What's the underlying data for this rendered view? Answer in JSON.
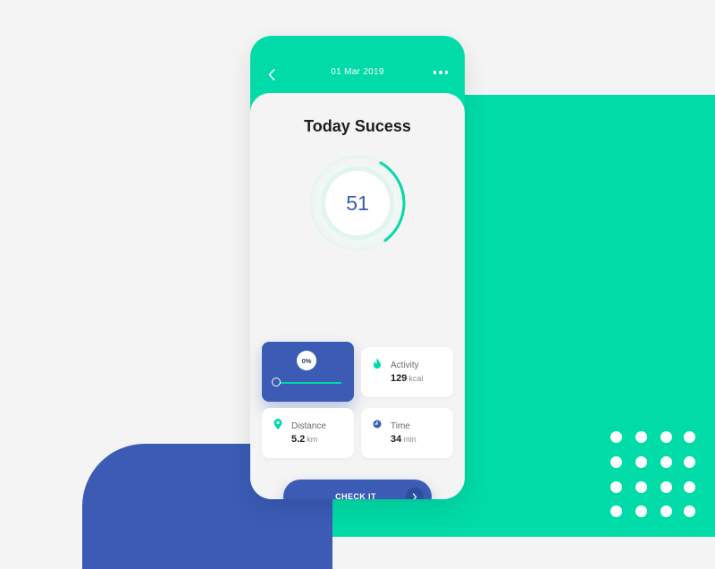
{
  "header": {
    "date": "01 Mar 2019",
    "back_icon": "chevron-left-icon",
    "more_icon": "more-horizontal-icon"
  },
  "title": "Today Sucess",
  "score": {
    "value": "51",
    "progress_fraction": 0.3
  },
  "progress_card": {
    "percent_label": "0%",
    "slider_value": 0
  },
  "cards": {
    "activity": {
      "icon": "flame-icon",
      "label": "Activity",
      "value": "129",
      "unit": "kcal"
    },
    "distance": {
      "icon": "map-pin-icon",
      "label": "Distance",
      "value": "5.2",
      "unit": "km"
    },
    "time": {
      "icon": "clock-icon",
      "label": "Time",
      "value": "34",
      "unit": "min"
    }
  },
  "button": {
    "label": "CHECK IT",
    "icon": "chevron-right-icon"
  },
  "colors": {
    "accent_green": "#00dba8",
    "accent_blue": "#3b5bb5",
    "background": "#f4f4f4",
    "card": "#ffffff",
    "text_dark": "#1c1c22"
  }
}
